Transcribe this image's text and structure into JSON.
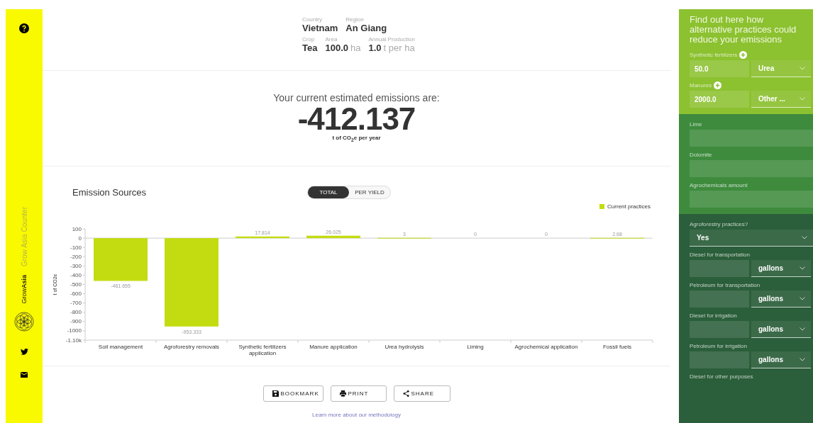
{
  "sidebar": {
    "app_name": "Grow Asia Counter",
    "logo_text": "Grow**Asia**"
  },
  "summary": {
    "rows": [
      [
        {
          "label": "Country",
          "value": "Vietnam"
        },
        {
          "label": "Region",
          "value": "An Giang"
        }
      ],
      [
        {
          "label": "Crop",
          "value": "Tea"
        },
        {
          "label": "Area",
          "value": "100.0",
          "unit": "ha"
        },
        {
          "label": "Annual Production",
          "value": "1.0",
          "unit": "t per ha"
        }
      ]
    ]
  },
  "emissions": {
    "intro": "Your current estimated emissions are:",
    "value": "-412.137",
    "unit": "t of CO$_{2}$e per year"
  },
  "chart_section": {
    "title": "Emission Sources",
    "toggle": [
      {
        "label": "TOTAL",
        "selected": true
      },
      {
        "label": "PER YIELD",
        "selected": false
      }
    ],
    "chart_data": {
      "type": "bar",
      "ylabel": "t of CO2e",
      "categories": [
        "Soil management",
        "Agroforestry removals",
        "Synthetic fertilizers application",
        "Manure application",
        "Urea hydrolysis",
        "Liming",
        "Agrochemical application",
        "Fossil fuels"
      ],
      "series": [
        {
          "name": "Current practices",
          "color": "#c3dc12",
          "values": [
            -461.655,
            -953.333,
            17.814,
            26.025,
            3,
            0,
            0,
            2.68
          ]
        }
      ],
      "value_labels": [
        "-461.655",
        "-953.333",
        "17.814",
        "26.025",
        "3",
        "0",
        "0",
        "2.68"
      ],
      "ylim": [
        -1100,
        100
      ],
      "yticks": [
        100,
        0,
        -100,
        -200,
        -300,
        -400,
        -500,
        -600,
        -700,
        -800,
        -900,
        -1000,
        {
          "value": -1100,
          "label": "-1.10k"
        }
      ]
    }
  },
  "actions": [
    {
      "kind": "bookmark",
      "label": "BOOKMARK"
    },
    {
      "kind": "print",
      "label": "PRINT"
    },
    {
      "kind": "share",
      "label": "SHARE"
    }
  ],
  "footer_link": "Learn more about our methodology",
  "panel": {
    "heading": "Find out here how alternative practices could reduce your emissions",
    "groups": [
      {
        "items": [
          {
            "kind": "amount_unit",
            "label": "Synthetic fertilizers",
            "addable": true,
            "value": "50.0",
            "unit": "Urea"
          },
          {
            "kind": "amount_unit",
            "label": "Manures",
            "addable": true,
            "value": "2000.0",
            "unit": "Other ..."
          }
        ]
      },
      {
        "items": [
          {
            "kind": "input",
            "label": "Lime",
            "addable": false
          },
          {
            "kind": "input",
            "label": "Dolomite",
            "addable": false
          },
          {
            "kind": "input",
            "label": "Agrochemicals amount",
            "addable": false
          }
        ]
      },
      {
        "items": [
          {
            "kind": "select",
            "label": "Agroforestry practices?",
            "addable": false,
            "value": "Yes"
          },
          {
            "kind": "amount_unit",
            "label": "Diesel for transportation",
            "addable": false,
            "unit": "gallons"
          },
          {
            "kind": "amount_unit",
            "label": "Petroleum for transportation",
            "addable": false,
            "unit": "gallons"
          },
          {
            "kind": "amount_unit",
            "label": "Diesel for irrigation",
            "addable": false,
            "unit": "gallons"
          },
          {
            "kind": "amount_unit",
            "label": "Petroleum for irrigation",
            "addable": false,
            "unit": "gallons"
          },
          {
            "kind": "label_only",
            "label": "Diesel for other purposes",
            "addable": false
          }
        ]
      }
    ]
  }
}
